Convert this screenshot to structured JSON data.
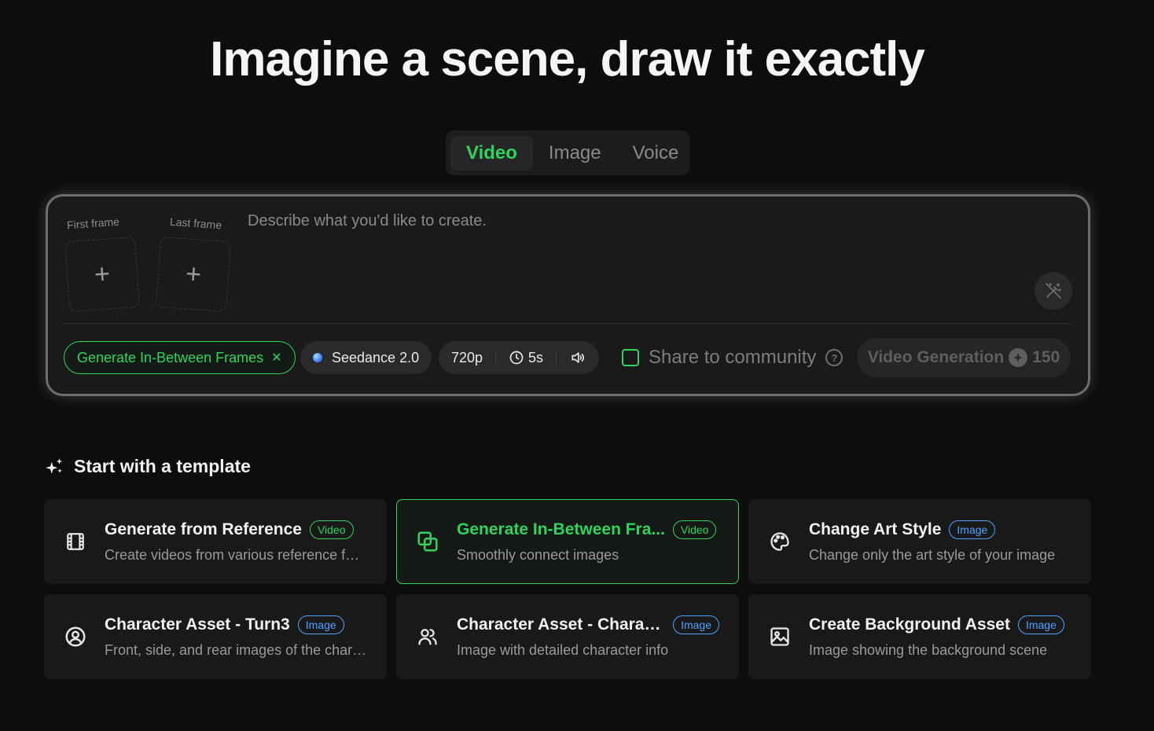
{
  "hero": {
    "title": "Imagine a scene, draw it exactly"
  },
  "mode_tabs": [
    {
      "label": "Video",
      "active": true
    },
    {
      "label": "Image",
      "active": false
    },
    {
      "label": "Voice",
      "active": false
    }
  ],
  "composer": {
    "first_frame_label": "First frame",
    "last_frame_label": "Last frame",
    "add_symbol": "+",
    "prompt_placeholder": "Describe what you'd like to create.",
    "template_chip": "Generate In-Between Frames",
    "model_chip": "Seedance 2.0",
    "resolution": "720p",
    "duration": "5s",
    "share_label": "Share to community",
    "help_symbol": "?",
    "generate_label": "Video Generation",
    "credits": "150"
  },
  "templates": {
    "section_title": "Start with a template",
    "cards": [
      {
        "title": "Generate from Reference",
        "badge": "Video",
        "subtitle": "Create videos from various reference for...",
        "icon": "film-icon",
        "selected": false
      },
      {
        "title": "Generate In-Between Fra...",
        "badge": "Video",
        "subtitle": "Smoothly connect images",
        "icon": "layers-icon",
        "selected": true
      },
      {
        "title": "Change Art Style",
        "badge": "Image",
        "subtitle": "Change only the art style of your image",
        "icon": "palette-icon",
        "selected": false
      },
      {
        "title": "Character Asset - Turn3",
        "badge": "Image",
        "subtitle": "Front, side, and rear images of the chara...",
        "icon": "user-circle-icon",
        "selected": false
      },
      {
        "title": "Character Asset - Charac...",
        "badge": "Image",
        "subtitle": "Image with detailed character info",
        "icon": "users-icon",
        "selected": false
      },
      {
        "title": "Create Background Asset",
        "badge": "Image",
        "subtitle": "Image showing the background scene",
        "icon": "image-icon",
        "selected": false
      }
    ]
  },
  "colors": {
    "accent_green": "#2fd35d",
    "image_badge_blue": "#4ea3ff",
    "background": "#0d0d0e"
  }
}
